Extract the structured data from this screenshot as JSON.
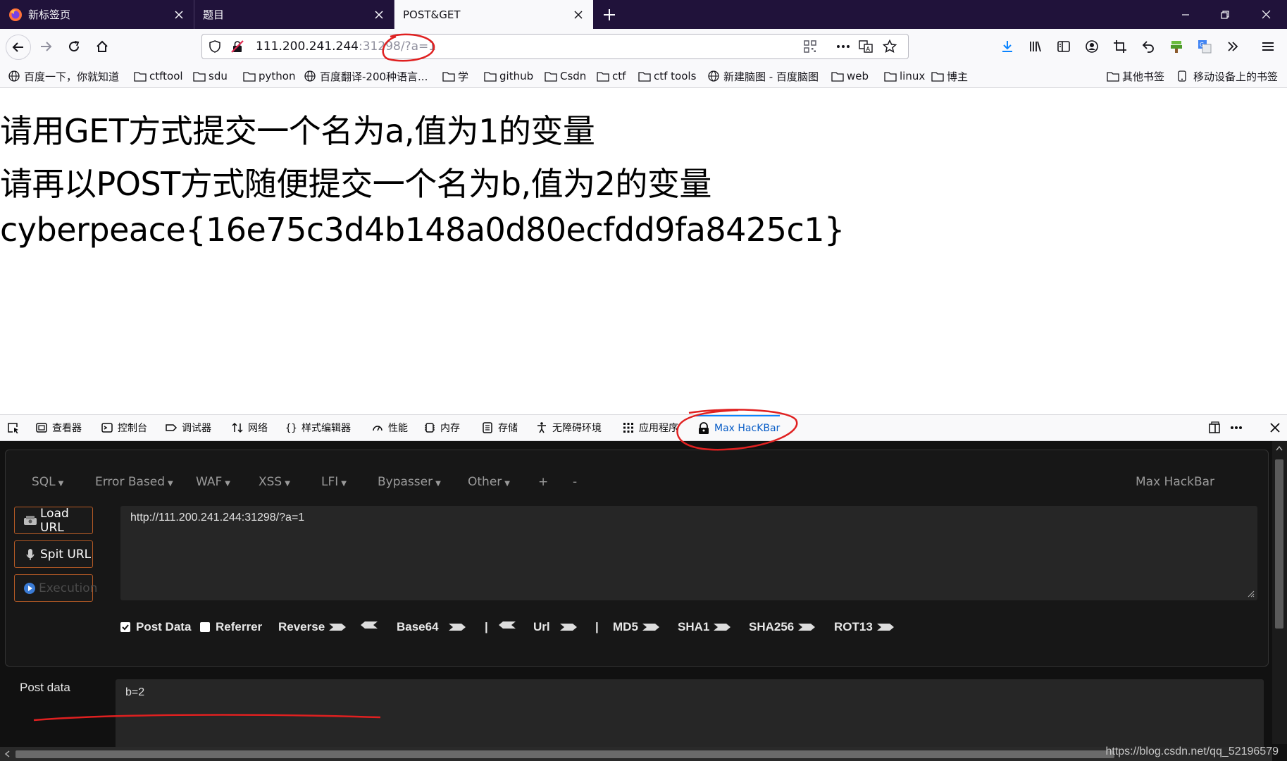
{
  "tabs": [
    {
      "title": "新标签页",
      "icon": "firefox-logo-icon"
    },
    {
      "title": "题目"
    },
    {
      "title": "POST&GET",
      "selected": true
    }
  ],
  "urlbar": {
    "host": "111.200.241.244",
    "port": ":31298",
    "path": "/?a=1"
  },
  "bookmarks": [
    {
      "label": "百度一下，你就知道",
      "icon": "globe-icon"
    },
    {
      "label": "ctftool",
      "icon": "folder-icon"
    },
    {
      "label": "sdu",
      "icon": "folder-icon"
    },
    {
      "label": "python",
      "icon": "folder-icon"
    },
    {
      "label": "百度翻译-200种语言...",
      "icon": "globe-icon"
    },
    {
      "label": "学",
      "icon": "folder-icon"
    },
    {
      "label": "github",
      "icon": "folder-icon"
    },
    {
      "label": "Csdn",
      "icon": "folder-icon"
    },
    {
      "label": "ctf",
      "icon": "folder-icon"
    },
    {
      "label": "ctf tools",
      "icon": "folder-icon"
    },
    {
      "label": "新建脑图 - 百度脑图",
      "icon": "globe-icon"
    },
    {
      "label": "web",
      "icon": "folder-icon"
    },
    {
      "label": "linux",
      "icon": "folder-icon"
    },
    {
      "label": "博主",
      "icon": "folder-icon"
    }
  ],
  "bookmarks_right": [
    {
      "label": "其他书签",
      "icon": "folder-icon"
    },
    {
      "label": "移动设备上的书签",
      "icon": "mobile-icon"
    }
  ],
  "page": {
    "line1": "请用GET方式提交一个名为a,值为1的变量",
    "line2": "请再以POST方式随便提交一个名为b,值为2的变量",
    "line3": "cyberpeace{16e75c3d4b148a0d80ecfdd9fa8425c1}"
  },
  "devtools": {
    "tabs": [
      {
        "label": "查看器",
        "icon": "inspector-icon"
      },
      {
        "label": "控制台",
        "icon": "console-icon"
      },
      {
        "label": "调试器",
        "icon": "debugger-icon"
      },
      {
        "label": "网络",
        "icon": "network-icon"
      },
      {
        "label": "样式编辑器",
        "icon": "style-editor-icon"
      },
      {
        "label": "性能",
        "icon": "performance-icon"
      },
      {
        "label": "内存",
        "icon": "memory-icon"
      },
      {
        "label": "存储",
        "icon": "storage-icon"
      },
      {
        "label": "无障碍环境",
        "icon": "accessibility-icon"
      },
      {
        "label": "应用程序",
        "icon": "application-icon"
      },
      {
        "label": "Max HacKBar",
        "icon": "hackbar-icon",
        "active": true
      }
    ]
  },
  "hackbar": {
    "menus": [
      "SQL",
      "Error Based",
      "WAF",
      "XSS",
      "LFI",
      "Bypasser",
      "Other",
      "+",
      "-"
    ],
    "brand": "Max HackBar",
    "buttons": {
      "load": "Load URL",
      "split": "Spit URL",
      "execute": "Execution"
    },
    "url_value": "http://111.200.241.244:31298/?a=1",
    "options": {
      "post_data": "Post Data",
      "referrer": "Referrer",
      "reverse": "Reverse",
      "base64": "Base64",
      "pipe": "|",
      "url": "Url",
      "md5": "MD5",
      "sha1": "SHA1",
      "sha256": "SHA256",
      "rot13": "ROT13"
    },
    "post_label": "Post data",
    "post_value": "b=2",
    "post_data_checked": true,
    "referrer_checked": false
  },
  "watermark": "https://blog.csdn.net/qq_52196579",
  "colors": {
    "tabstrip": "#20123a",
    "annotation_red": "#e02020",
    "hackbar_bg": "#111111",
    "hackbar_button_border": "#b55a25",
    "devtools_active": "#0a84ff"
  }
}
